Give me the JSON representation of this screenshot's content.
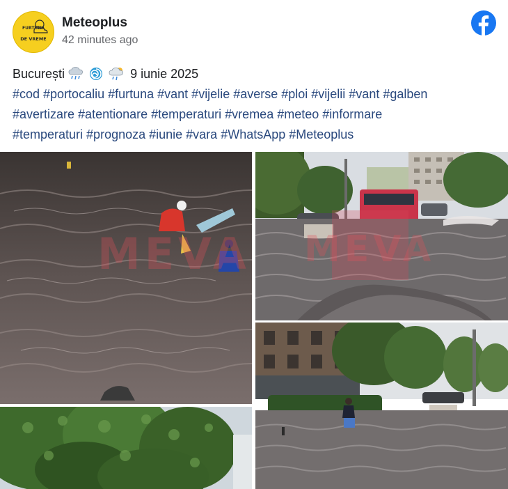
{
  "page": {
    "author": "Meteoplus",
    "timestamp": "42 minutes ago",
    "avatar": {
      "line1": "FURTUNA",
      "line2": "DE VREME",
      "colors": {
        "background": "#f6cf1f"
      }
    },
    "brand_icon": "facebook-icon",
    "colors": {
      "facebook_blue": "#1877f2",
      "hashtag": "#29487d",
      "muted": "#65676b"
    }
  },
  "post": {
    "location": "București",
    "icons": [
      "cloud-rain-icon",
      "cyclone-icon",
      "cloud-rain-sun-icon"
    ],
    "date": "9 iunie 2025",
    "hashtag_lines": [
      "#cod #portocaliu #furtuna #vant #vijelie #averse #ploi #vijelii #vant #galben",
      "#avertizare #atentionare #temperaturi #vremea #meteo #informare",
      "#temperaturi #prognoza #iunie #vara #WhatsApp #Meteoplus"
    ]
  },
  "gallery": {
    "watermark": "MEVA",
    "photos": [
      {
        "name": "flooded-street-rescue-photo"
      },
      {
        "name": "flooded-boulevard-bus-photo"
      },
      {
        "name": "person-wading-flood-photo"
      },
      {
        "name": "tree-canopy-photo"
      }
    ]
  }
}
